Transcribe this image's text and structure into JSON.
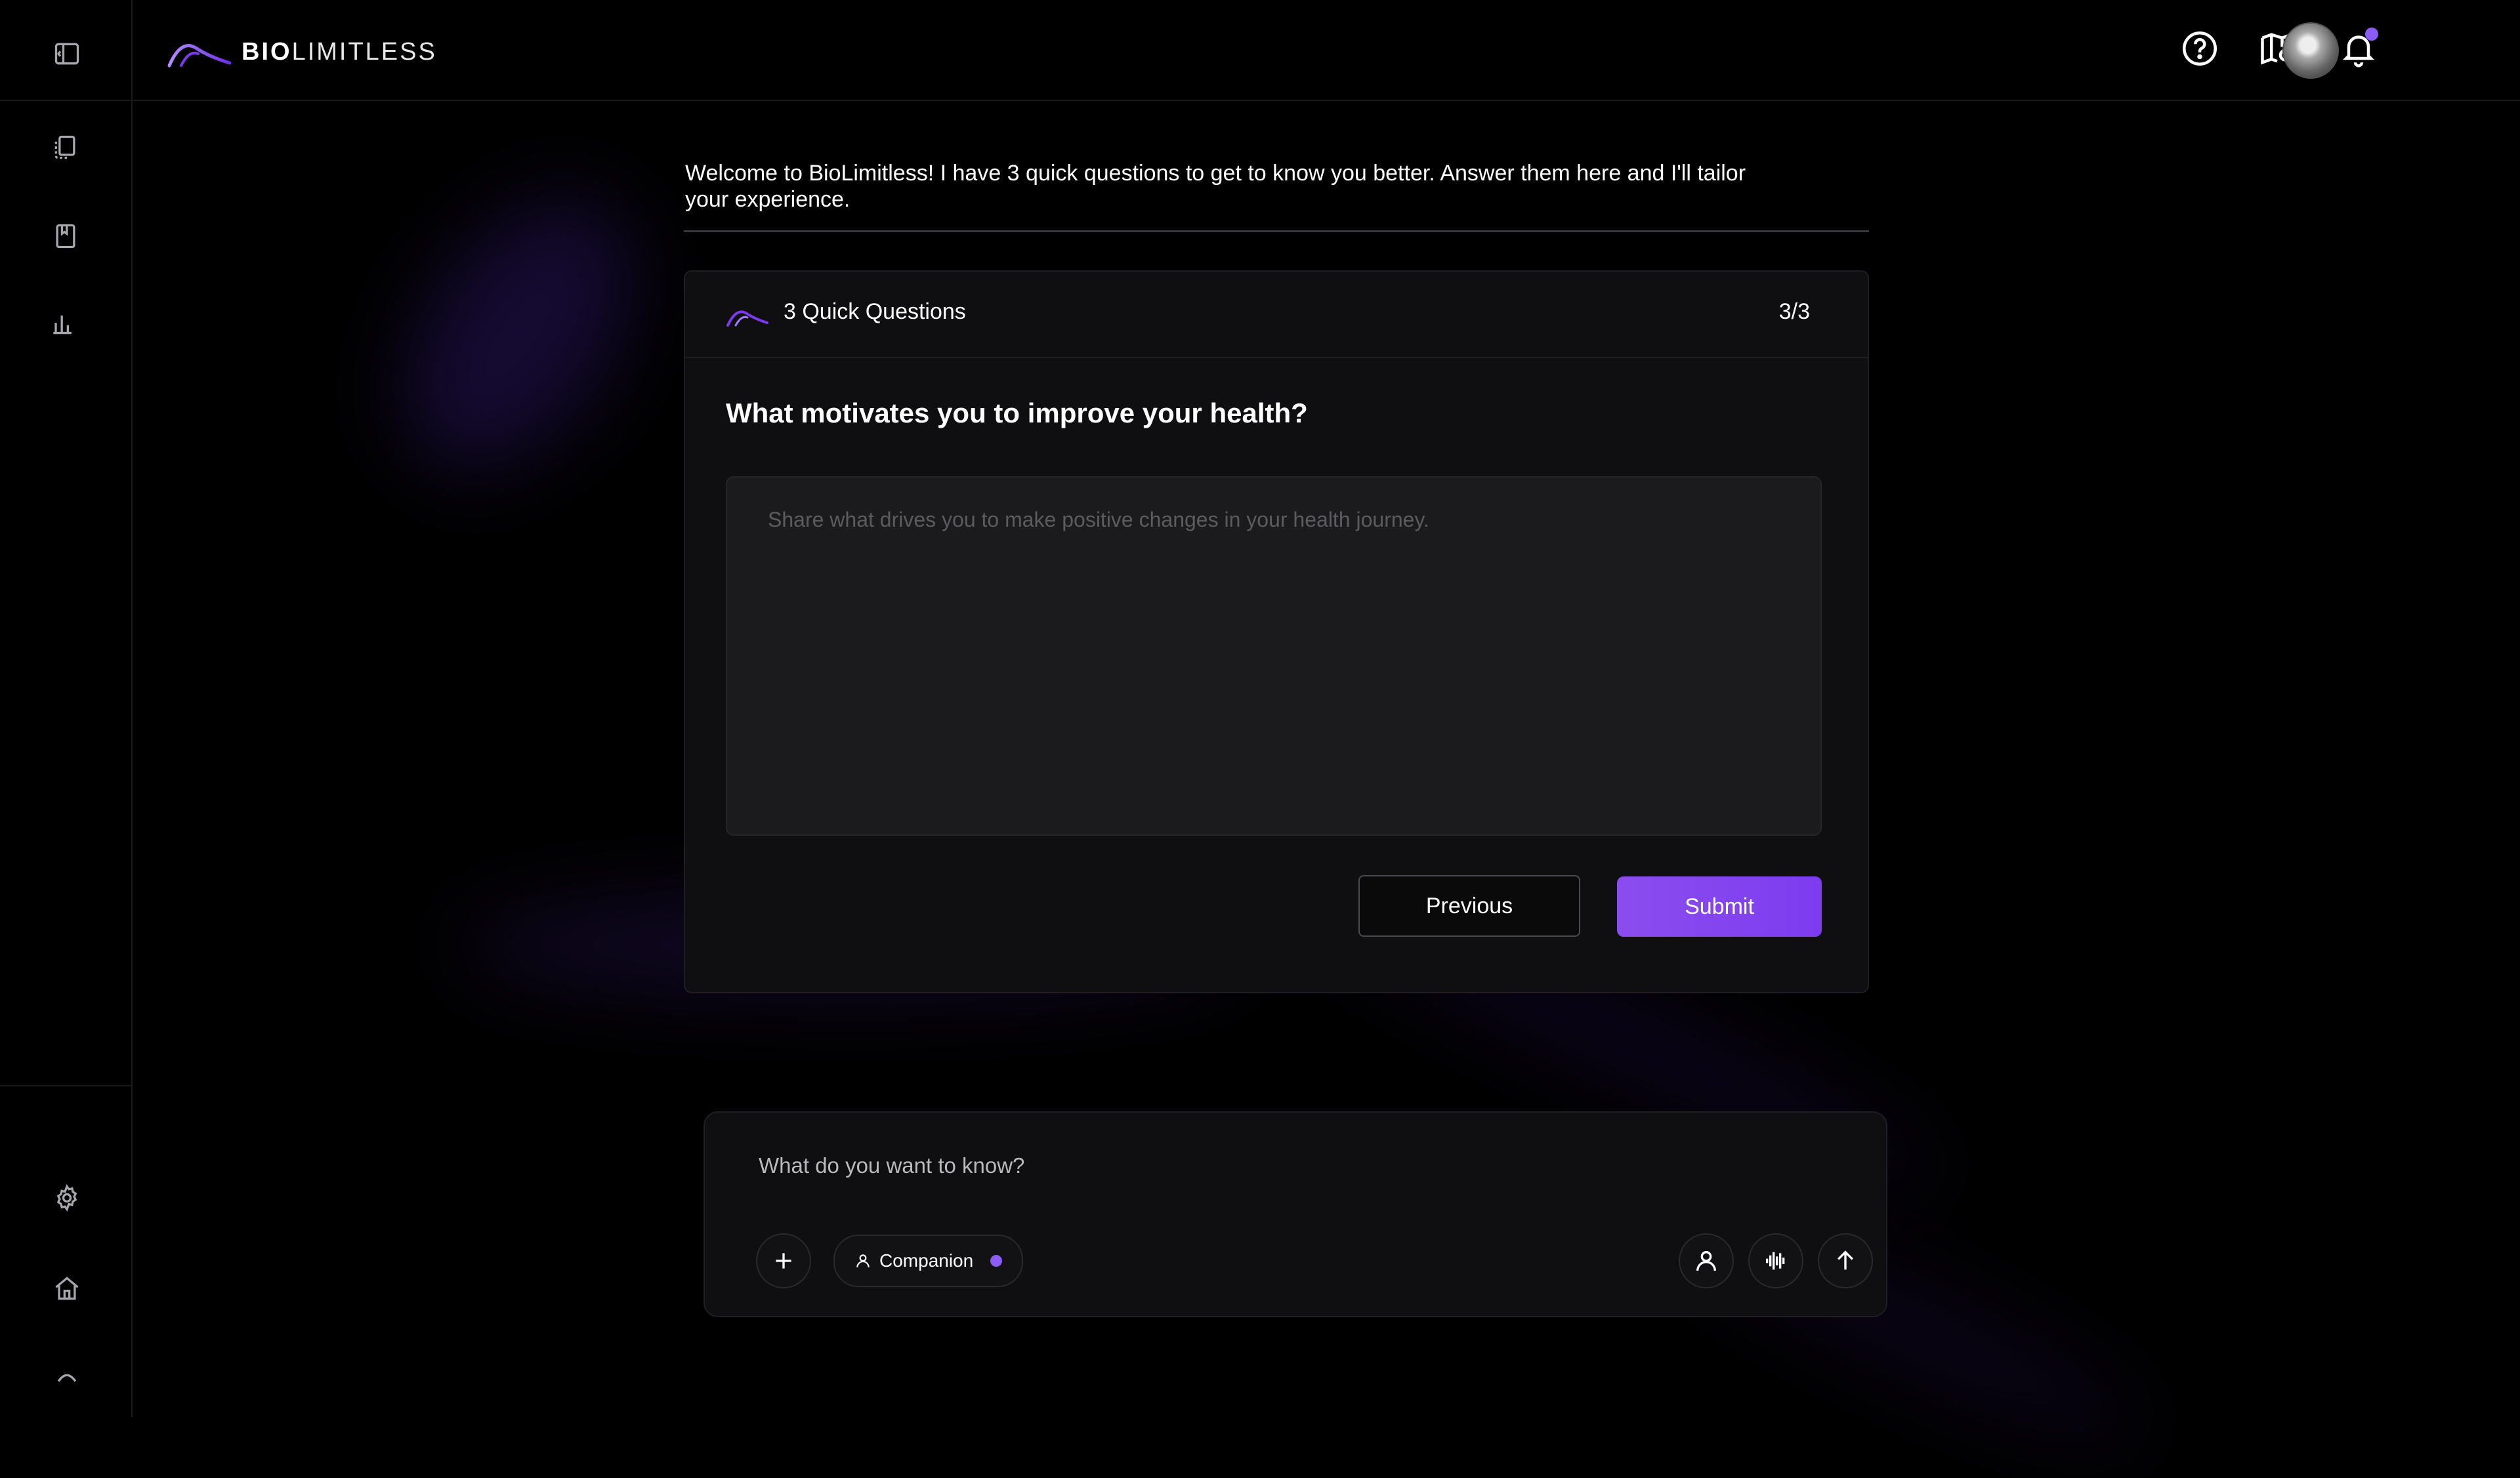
{
  "app": {
    "logo_bold": "BIO",
    "logo_light": "LIMITLESS",
    "accent_color": "#8b5cf6"
  },
  "sidebar": {
    "items": [
      {
        "name": "toggle-sidebar",
        "icon": "sidebar-toggle-icon"
      },
      {
        "name": "documents",
        "icon": "documents-icon"
      },
      {
        "name": "bookmarks",
        "icon": "bookmark-icon"
      },
      {
        "name": "analytics",
        "icon": "bar-chart-icon"
      },
      {
        "name": "settings",
        "icon": "gear-icon"
      },
      {
        "name": "home",
        "icon": "home-icon"
      },
      {
        "name": "brand",
        "icon": "logo-mark-icon"
      }
    ]
  },
  "header": {
    "icons": [
      "help-icon",
      "map-search-icon",
      "bell-icon",
      "avatar"
    ],
    "has_notification": true
  },
  "main": {
    "welcome_text": "Welcome to BioLimitless! I have 3 quick questions to get to know you better. Answer them here and I'll tailor your experience.",
    "card": {
      "title": "3 Quick Questions",
      "counter": "3/3",
      "question": "What motivates you to improve your health?",
      "answer_placeholder": "Share what drives you to make positive changes in your health journey.",
      "answer_value": "",
      "previous_label": "Previous",
      "submit_label": "Submit"
    }
  },
  "composer": {
    "placeholder": "What do you want to know?",
    "mode_label": "Companion",
    "left_icons": [
      "plus-icon"
    ],
    "right_icons": [
      "person-icon",
      "audio-wave-icon",
      "arrow-up-icon"
    ]
  }
}
